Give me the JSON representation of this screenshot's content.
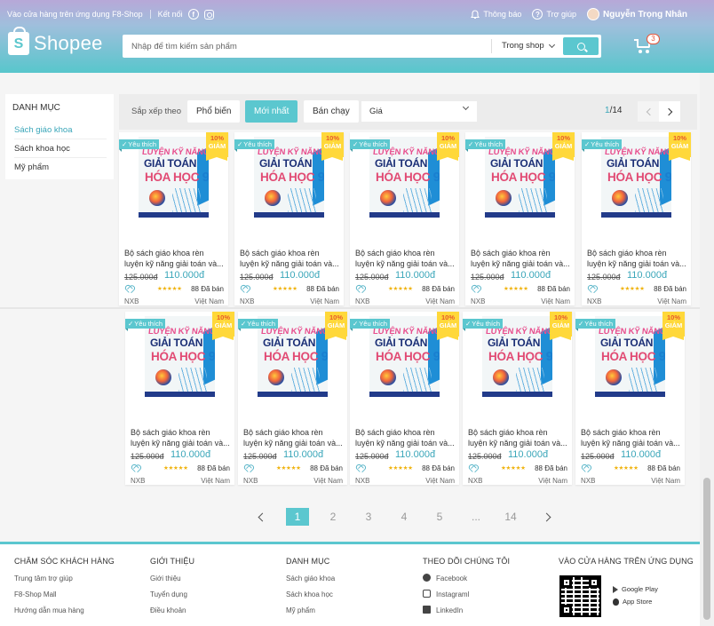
{
  "topbar": {
    "app_link": "Vào cửa hàng trên ứng dụng F8-Shop",
    "connect": "Kết nối",
    "notifications": "Thông báo",
    "help": "Trợ giúp",
    "username": "Nguyễn Trọng Nhân"
  },
  "header": {
    "logo": "Shopee",
    "search_placeholder": "Nhập để tìm kiếm sản phẩm",
    "search_scope": "Trong shop",
    "cart_count": "3"
  },
  "sidebar": {
    "title": "DANH MỤC",
    "items": [
      "Sách giáo khoa",
      "Sách khoa học",
      "Mỹ phẩm"
    ]
  },
  "filter": {
    "sort_label": "Sắp xếp theo",
    "options": [
      "Phổ biến",
      "Mới nhất",
      "Bán chạy"
    ],
    "active": "Mới nhất",
    "price": "Giá",
    "page_current": "1",
    "page_total": "/14"
  },
  "product": {
    "like_label": "Yêu thích",
    "discount_pct": "10%",
    "discount_label": "GIẢM",
    "cover_line1": "LUYỆN KỸ NĂNG",
    "cover_line2": "GIẢI TOÁN",
    "cover_line3": "HÓA HỌC",
    "cover_grade": "9",
    "name_line1": "Bộ sách giáo khoa rèn",
    "name_line2": "luyện kỹ năng giải toán và...",
    "old_price": "125.000đ",
    "new_price": "110.000đ",
    "rating": 5,
    "stars": "★★★★★",
    "sold": "88 Đã bán",
    "brand": "NXB",
    "origin": "Việt Nam"
  },
  "pagination": {
    "pages": [
      "1",
      "2",
      "3",
      "4",
      "5",
      "...",
      "14"
    ],
    "active": "1"
  },
  "footer": {
    "columns": [
      {
        "title": "CHĂM SÓC KHÁCH HÀNG",
        "links": [
          "Trung tâm trợ giúp",
          "F8-Shop Mall",
          "Hướng dẫn mua hàng"
        ]
      },
      {
        "title": "GIỚI THIỆU",
        "links": [
          "Giới thiệu",
          "Tuyển dụng",
          "Điều khoản"
        ]
      },
      {
        "title": "DANH MỤC",
        "links": [
          "Sách giáo khoa",
          "Sách khoa học",
          "Mỹ phẩm"
        ]
      },
      {
        "title": "THEO DÕI CHÚNG TÔI",
        "links": [
          "Facebook",
          "Instagraml",
          "LinkedIn"
        ]
      },
      {
        "title": "VÀO CỬA HÀNG TRÊN ỨNG DỤNG",
        "links": [
          "Google Play",
          "App Store"
        ]
      }
    ]
  },
  "colors": {
    "accent": "#5bc7cf",
    "accent_text": "#3aa6b9",
    "discount_bg": "#ffd83a",
    "star": "#f0b30f"
  }
}
